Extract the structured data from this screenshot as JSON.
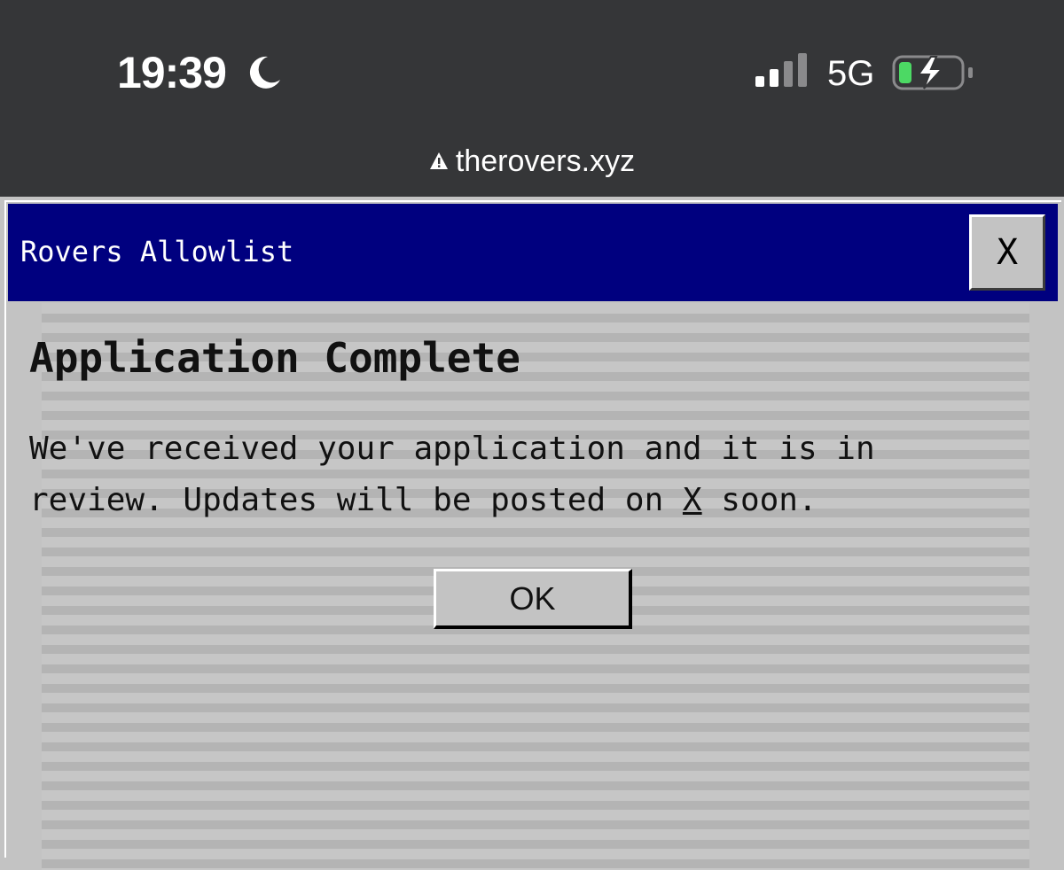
{
  "status_bar": {
    "time": "19:39",
    "network": "5G",
    "icons": [
      "moon-icon",
      "signal-icon",
      "battery-charging-icon"
    ],
    "battery_color": "#4cd964"
  },
  "browser": {
    "url": "therovers.xyz",
    "security_icon": "warning-icon"
  },
  "dialog": {
    "title": "Rovers Allowlist",
    "close_label": "X",
    "heading": "Application Complete",
    "message_part1": "We've received your application and it is in review. Updates will be posted on ",
    "message_link": "X",
    "message_part2": " soon.",
    "ok_label": "OK",
    "titlebar_color": "#00007f",
    "background_color": "#c3c3c3"
  }
}
